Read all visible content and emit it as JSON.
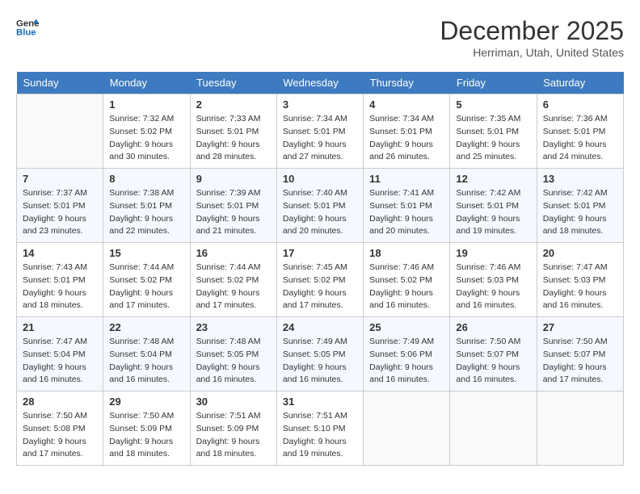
{
  "logo": {
    "line1": "General",
    "line2": "Blue"
  },
  "title": "December 2025",
  "location": "Herriman, Utah, United States",
  "headers": [
    "Sunday",
    "Monday",
    "Tuesday",
    "Wednesday",
    "Thursday",
    "Friday",
    "Saturday"
  ],
  "weeks": [
    [
      {
        "day": "",
        "sunrise": "",
        "sunset": "",
        "daylight": ""
      },
      {
        "day": "1",
        "sunrise": "Sunrise: 7:32 AM",
        "sunset": "Sunset: 5:02 PM",
        "daylight": "Daylight: 9 hours and 30 minutes."
      },
      {
        "day": "2",
        "sunrise": "Sunrise: 7:33 AM",
        "sunset": "Sunset: 5:01 PM",
        "daylight": "Daylight: 9 hours and 28 minutes."
      },
      {
        "day": "3",
        "sunrise": "Sunrise: 7:34 AM",
        "sunset": "Sunset: 5:01 PM",
        "daylight": "Daylight: 9 hours and 27 minutes."
      },
      {
        "day": "4",
        "sunrise": "Sunrise: 7:34 AM",
        "sunset": "Sunset: 5:01 PM",
        "daylight": "Daylight: 9 hours and 26 minutes."
      },
      {
        "day": "5",
        "sunrise": "Sunrise: 7:35 AM",
        "sunset": "Sunset: 5:01 PM",
        "daylight": "Daylight: 9 hours and 25 minutes."
      },
      {
        "day": "6",
        "sunrise": "Sunrise: 7:36 AM",
        "sunset": "Sunset: 5:01 PM",
        "daylight": "Daylight: 9 hours and 24 minutes."
      }
    ],
    [
      {
        "day": "7",
        "sunrise": "Sunrise: 7:37 AM",
        "sunset": "Sunset: 5:01 PM",
        "daylight": "Daylight: 9 hours and 23 minutes."
      },
      {
        "day": "8",
        "sunrise": "Sunrise: 7:38 AM",
        "sunset": "Sunset: 5:01 PM",
        "daylight": "Daylight: 9 hours and 22 minutes."
      },
      {
        "day": "9",
        "sunrise": "Sunrise: 7:39 AM",
        "sunset": "Sunset: 5:01 PM",
        "daylight": "Daylight: 9 hours and 21 minutes."
      },
      {
        "day": "10",
        "sunrise": "Sunrise: 7:40 AM",
        "sunset": "Sunset: 5:01 PM",
        "daylight": "Daylight: 9 hours and 20 minutes."
      },
      {
        "day": "11",
        "sunrise": "Sunrise: 7:41 AM",
        "sunset": "Sunset: 5:01 PM",
        "daylight": "Daylight: 9 hours and 20 minutes."
      },
      {
        "day": "12",
        "sunrise": "Sunrise: 7:42 AM",
        "sunset": "Sunset: 5:01 PM",
        "daylight": "Daylight: 9 hours and 19 minutes."
      },
      {
        "day": "13",
        "sunrise": "Sunrise: 7:42 AM",
        "sunset": "Sunset: 5:01 PM",
        "daylight": "Daylight: 9 hours and 18 minutes."
      }
    ],
    [
      {
        "day": "14",
        "sunrise": "Sunrise: 7:43 AM",
        "sunset": "Sunset: 5:01 PM",
        "daylight": "Daylight: 9 hours and 18 minutes."
      },
      {
        "day": "15",
        "sunrise": "Sunrise: 7:44 AM",
        "sunset": "Sunset: 5:02 PM",
        "daylight": "Daylight: 9 hours and 17 minutes."
      },
      {
        "day": "16",
        "sunrise": "Sunrise: 7:44 AM",
        "sunset": "Sunset: 5:02 PM",
        "daylight": "Daylight: 9 hours and 17 minutes."
      },
      {
        "day": "17",
        "sunrise": "Sunrise: 7:45 AM",
        "sunset": "Sunset: 5:02 PM",
        "daylight": "Daylight: 9 hours and 17 minutes."
      },
      {
        "day": "18",
        "sunrise": "Sunrise: 7:46 AM",
        "sunset": "Sunset: 5:02 PM",
        "daylight": "Daylight: 9 hours and 16 minutes."
      },
      {
        "day": "19",
        "sunrise": "Sunrise: 7:46 AM",
        "sunset": "Sunset: 5:03 PM",
        "daylight": "Daylight: 9 hours and 16 minutes."
      },
      {
        "day": "20",
        "sunrise": "Sunrise: 7:47 AM",
        "sunset": "Sunset: 5:03 PM",
        "daylight": "Daylight: 9 hours and 16 minutes."
      }
    ],
    [
      {
        "day": "21",
        "sunrise": "Sunrise: 7:47 AM",
        "sunset": "Sunset: 5:04 PM",
        "daylight": "Daylight: 9 hours and 16 minutes."
      },
      {
        "day": "22",
        "sunrise": "Sunrise: 7:48 AM",
        "sunset": "Sunset: 5:04 PM",
        "daylight": "Daylight: 9 hours and 16 minutes."
      },
      {
        "day": "23",
        "sunrise": "Sunrise: 7:48 AM",
        "sunset": "Sunset: 5:05 PM",
        "daylight": "Daylight: 9 hours and 16 minutes."
      },
      {
        "day": "24",
        "sunrise": "Sunrise: 7:49 AM",
        "sunset": "Sunset: 5:05 PM",
        "daylight": "Daylight: 9 hours and 16 minutes."
      },
      {
        "day": "25",
        "sunrise": "Sunrise: 7:49 AM",
        "sunset": "Sunset: 5:06 PM",
        "daylight": "Daylight: 9 hours and 16 minutes."
      },
      {
        "day": "26",
        "sunrise": "Sunrise: 7:50 AM",
        "sunset": "Sunset: 5:07 PM",
        "daylight": "Daylight: 9 hours and 16 minutes."
      },
      {
        "day": "27",
        "sunrise": "Sunrise: 7:50 AM",
        "sunset": "Sunset: 5:07 PM",
        "daylight": "Daylight: 9 hours and 17 minutes."
      }
    ],
    [
      {
        "day": "28",
        "sunrise": "Sunrise: 7:50 AM",
        "sunset": "Sunset: 5:08 PM",
        "daylight": "Daylight: 9 hours and 17 minutes."
      },
      {
        "day": "29",
        "sunrise": "Sunrise: 7:50 AM",
        "sunset": "Sunset: 5:09 PM",
        "daylight": "Daylight: 9 hours and 18 minutes."
      },
      {
        "day": "30",
        "sunrise": "Sunrise: 7:51 AM",
        "sunset": "Sunset: 5:09 PM",
        "daylight": "Daylight: 9 hours and 18 minutes."
      },
      {
        "day": "31",
        "sunrise": "Sunrise: 7:51 AM",
        "sunset": "Sunset: 5:10 PM",
        "daylight": "Daylight: 9 hours and 19 minutes."
      },
      {
        "day": "",
        "sunrise": "",
        "sunset": "",
        "daylight": ""
      },
      {
        "day": "",
        "sunrise": "",
        "sunset": "",
        "daylight": ""
      },
      {
        "day": "",
        "sunrise": "",
        "sunset": "",
        "daylight": ""
      }
    ]
  ]
}
